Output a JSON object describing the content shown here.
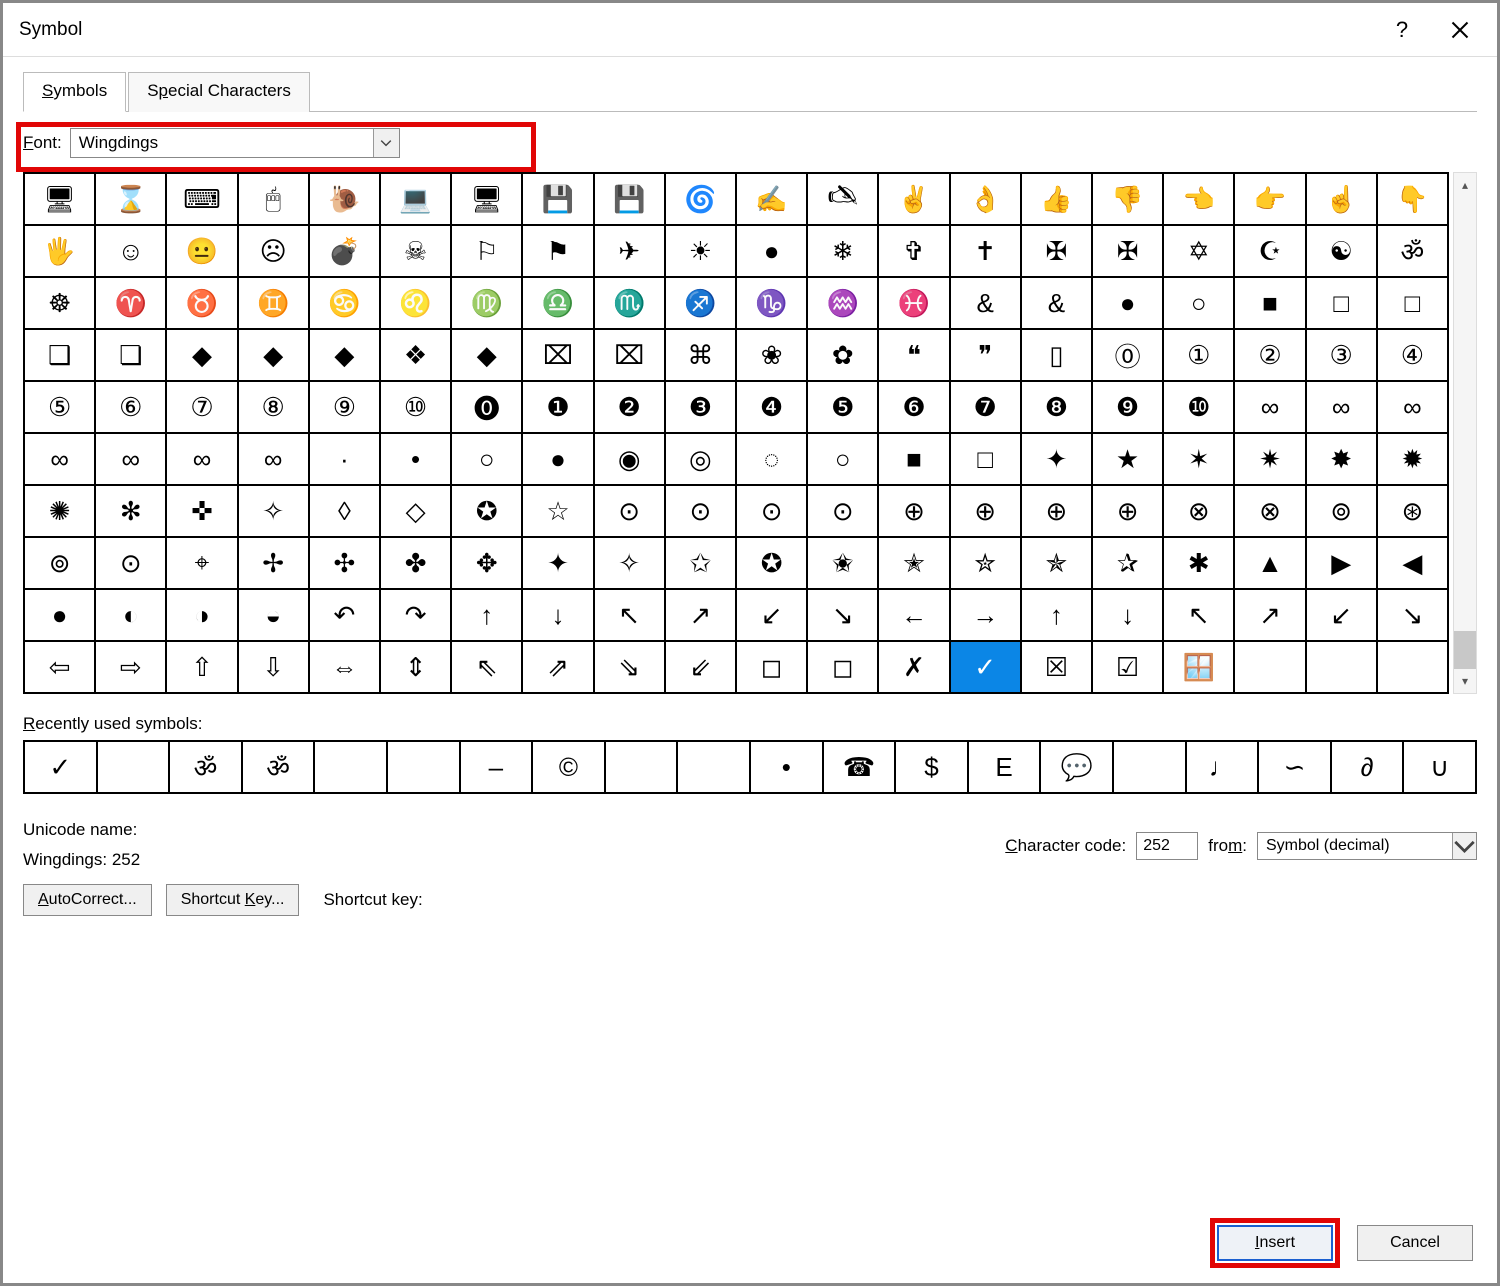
{
  "title": "Symbol",
  "tabs": {
    "symbols": "Symbols",
    "special": "Special Characters"
  },
  "font": {
    "label": "Font:",
    "value": "Wingdings"
  },
  "grid": [
    [
      "🖥",
      "⌛",
      "⌨",
      "🖱",
      "🐌",
      "💻",
      "🖥",
      "💾",
      "💾",
      "🌀",
      "✍",
      "🖎",
      "✌",
      "👌",
      "👍",
      "👎",
      "👈",
      "👉",
      "☝",
      "👇"
    ],
    [
      "🖐",
      "☺",
      "😐",
      "☹",
      "💣",
      "☠",
      "⚐",
      "⚑",
      "✈",
      "☀",
      "●",
      "❄",
      "✞",
      "✝",
      "✠",
      "✠",
      "✡",
      "☪",
      "☯",
      "ॐ"
    ],
    [
      "☸",
      "♈",
      "♉",
      "♊",
      "♋",
      "♌",
      "♍",
      "♎",
      "♏",
      "♐",
      "♑",
      "♒",
      "♓",
      "&",
      "&",
      "●",
      "○",
      "■",
      "□",
      "□"
    ],
    [
      "❑",
      "❏",
      "◆",
      "◆",
      "◆",
      "❖",
      "◆",
      "⌧",
      "⌧",
      "⌘",
      "❀",
      "✿",
      "❝",
      "❞",
      "▯",
      "⓪",
      "①",
      "②",
      "③",
      "④"
    ],
    [
      "⑤",
      "⑥",
      "⑦",
      "⑧",
      "⑨",
      "⑩",
      "⓿",
      "❶",
      "❷",
      "❸",
      "❹",
      "❺",
      "❻",
      "❼",
      "❽",
      "❾",
      "❿",
      "∞",
      "∞",
      "∞"
    ],
    [
      "∞",
      "∞",
      "∞",
      "∞",
      "·",
      "•",
      "○",
      "●",
      "◉",
      "◎",
      "◌",
      "○",
      "■",
      "□",
      "✦",
      "★",
      "✶",
      "✷",
      "✸",
      "✹"
    ],
    [
      "✺",
      "✻",
      "✜",
      "✧",
      "◊",
      "◇",
      "✪",
      "☆",
      "⊙",
      "⊙",
      "⊙",
      "⊙",
      "⊕",
      "⊕",
      "⊕",
      "⊕",
      "⊗",
      "⊗",
      "⊚",
      "⊛"
    ],
    [
      "⊚",
      "⊙",
      "⌖",
      "✢",
      "✣",
      "✤",
      "✥",
      "✦",
      "✧",
      "✩",
      "✪",
      "✬",
      "✭",
      "✮",
      "✯",
      "✰",
      "✱",
      "▲",
      "▶",
      "◀"
    ],
    [
      "●",
      "◐",
      "◑",
      "◒",
      "↶",
      "↷",
      "↑",
      "↓",
      "↖",
      "↗",
      "↙",
      "↘",
      "←",
      "→",
      "↑",
      "↓",
      "↖",
      "↗",
      "↙",
      "↘"
    ],
    [
      "⇦",
      "⇨",
      "⇧",
      "⇩",
      "⇔",
      "⇕",
      "⇖",
      "⇗",
      "⇘",
      "⇙",
      "◻",
      "◻",
      "✗",
      "✓",
      "☒",
      "☑",
      "🪟",
      "",
      "",
      ""
    ]
  ],
  "selected": {
    "row": 9,
    "col": 13
  },
  "recent_label": "Recently used symbols:",
  "recent": [
    "✓",
    "",
    "ॐ",
    "ॐ",
    "",
    "",
    "–",
    "©",
    "",
    "",
    "•",
    "☎",
    "$",
    "E",
    "💬",
    "",
    "♩",
    "∽",
    "∂",
    "∪"
  ],
  "unicode_name_label": "Unicode name:",
  "unicode_name_value": "Wingdings: 252",
  "char_code_label": "Character code:",
  "char_code_value": "252",
  "from_label": "from:",
  "from_value": "Symbol (decimal)",
  "autocorrect_btn": "AutoCorrect...",
  "shortcutkey_btn": "Shortcut Key...",
  "shortcutkey_label": "Shortcut key:",
  "insert_btn": "Insert",
  "cancel_btn": "Cancel"
}
